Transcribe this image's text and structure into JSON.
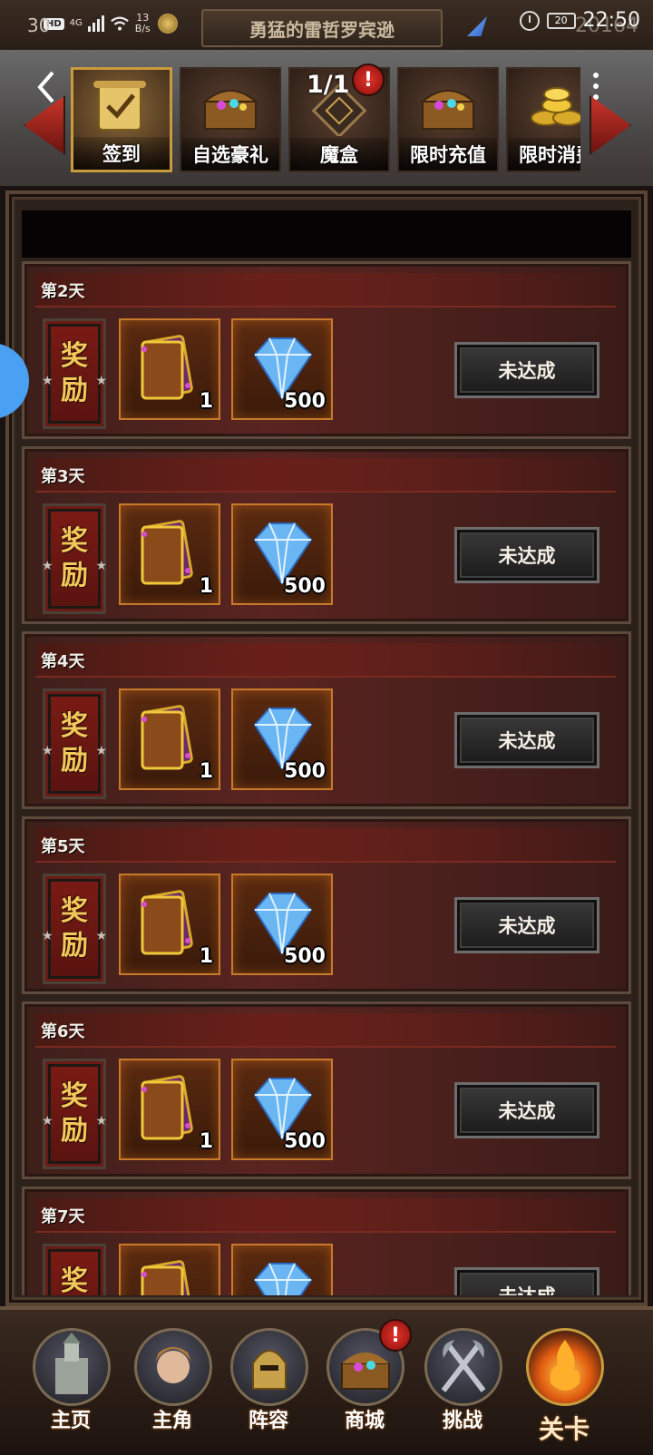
{
  "status_bar": {
    "left_number": "30",
    "hd": "HD",
    "network": "4G",
    "speed_value": "13",
    "speed_unit": "B/s",
    "battery": "20",
    "time": "22:50",
    "power_readout": "20164"
  },
  "title": "勇猛的雷哲罗宾逊",
  "pager": "1/1",
  "alert": "!",
  "tabs": [
    {
      "label": "签到",
      "icon": "scroll-icon",
      "active": true
    },
    {
      "label": "自选豪礼",
      "icon": "chest-icon",
      "active": false
    },
    {
      "label": "魔盒",
      "icon": "magic-box-icon",
      "active": false
    },
    {
      "label": "限时充值",
      "icon": "chest-icon",
      "active": false
    },
    {
      "label": "限时消费",
      "icon": "gold-coins-icon",
      "active": false
    }
  ],
  "reward_label": [
    "奖",
    "励"
  ],
  "rows": [
    {
      "day": "第2天",
      "items": [
        {
          "icon": "vip-card-icon",
          "qty": "1"
        },
        {
          "icon": "diamond-icon",
          "qty": "500"
        }
      ],
      "status": "未达成"
    },
    {
      "day": "第3天",
      "items": [
        {
          "icon": "vip-card-icon",
          "qty": "1"
        },
        {
          "icon": "diamond-icon",
          "qty": "500"
        }
      ],
      "status": "未达成"
    },
    {
      "day": "第4天",
      "items": [
        {
          "icon": "vip-card-icon",
          "qty": "1"
        },
        {
          "icon": "diamond-icon",
          "qty": "500"
        }
      ],
      "status": "未达成"
    },
    {
      "day": "第5天",
      "items": [
        {
          "icon": "vip-card-icon",
          "qty": "1"
        },
        {
          "icon": "diamond-icon",
          "qty": "500"
        }
      ],
      "status": "未达成"
    },
    {
      "day": "第6天",
      "items": [
        {
          "icon": "vip-card-icon",
          "qty": "1"
        },
        {
          "icon": "diamond-icon",
          "qty": "500"
        }
      ],
      "status": "未达成"
    },
    {
      "day": "第7天",
      "items": [
        {
          "icon": "vip-card-icon",
          "qty": ""
        },
        {
          "icon": "diamond-icon",
          "qty": ""
        }
      ],
      "status": "未达成"
    }
  ],
  "bottom_nav": [
    {
      "label": "主页",
      "icon": "castle-icon",
      "active": false
    },
    {
      "label": "主角",
      "icon": "hero-portrait-icon",
      "active": false
    },
    {
      "label": "阵容",
      "icon": "knight-helmet-icon",
      "active": false
    },
    {
      "label": "商城",
      "icon": "treasure-chest-icon",
      "active": false,
      "badge": "!"
    },
    {
      "label": "挑战",
      "icon": "crossed-axes-icon",
      "active": false
    },
    {
      "label": "关卡",
      "icon": "flame-emblem-icon",
      "active": true
    }
  ],
  "colors": {
    "accent_gold": "#c89b3c",
    "row_red": "#5a2420",
    "alert_red": "#d62c24",
    "float_blue": "#4aa0f2"
  }
}
